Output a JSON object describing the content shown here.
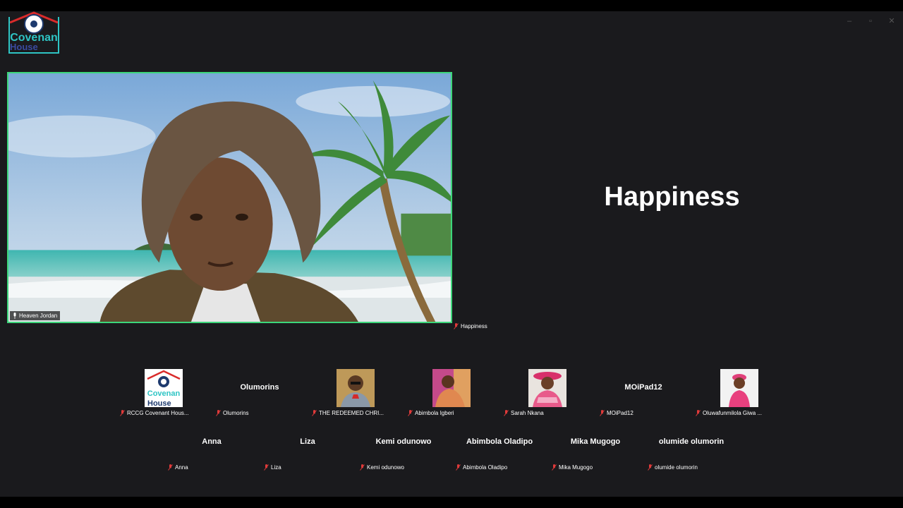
{
  "brand": {
    "logo_line1": "Covenan",
    "logo_line2": "House"
  },
  "main_speaker": {
    "name": "Heaven Jordan"
  },
  "side_panel": {
    "title": "Happiness",
    "name": "Happiness"
  },
  "participants_row1": [
    {
      "display": "",
      "label": "RCCG Covenant Hous...",
      "avatar": "logo"
    },
    {
      "display": "Olumorins",
      "label": "Olumorins",
      "avatar": "none"
    },
    {
      "display": "",
      "label": "THE REDEEMED CHRI...",
      "avatar": "photo-man"
    },
    {
      "display": "",
      "label": "Abimbola Igberi",
      "avatar": "photo-woman-pink"
    },
    {
      "display": "",
      "label": "Sarah Nkana",
      "avatar": "photo-woman-hat"
    },
    {
      "display": "MOiPad12",
      "label": "MOiPad12",
      "avatar": "none"
    },
    {
      "display": "",
      "label": "Oluwafunmilola Giwa ...",
      "avatar": "photo-woman-dress"
    }
  ],
  "participants_row2": [
    {
      "display": "Anna",
      "label": "Anna"
    },
    {
      "display": "Liza",
      "label": "Liza"
    },
    {
      "display": "Kemi odunowo",
      "label": "Kemi odunowo"
    },
    {
      "display": "Abimbola Oladipo",
      "label": "Abimbola Oladipo"
    },
    {
      "display": "Mika Mugogo",
      "label": "Mika Mugogo"
    },
    {
      "display": "olumide olumorin",
      "label": "olumide olumorin"
    }
  ],
  "colors": {
    "active_speaker_border": "#3cd67a",
    "muted_icon": "#e03a3a",
    "background": "#1a1a1d"
  }
}
